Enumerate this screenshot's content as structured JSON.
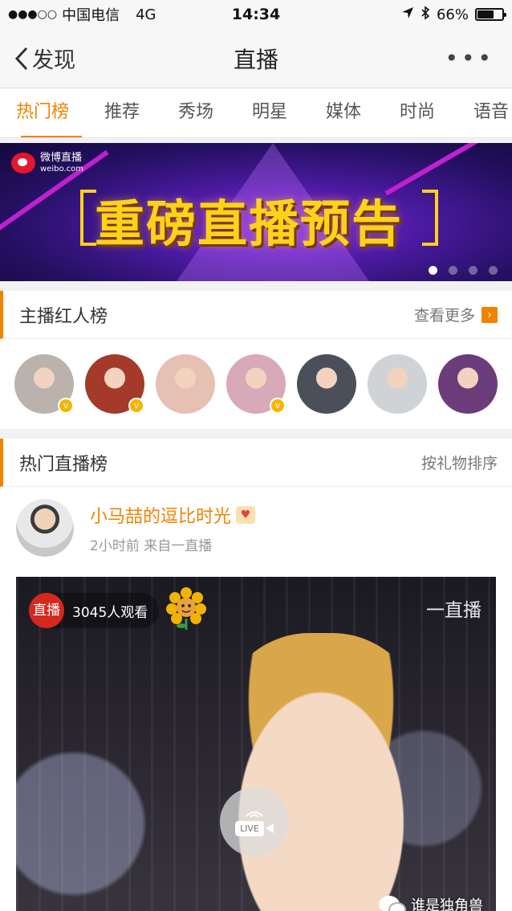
{
  "status_bar": {
    "carrier": "中国电信",
    "network": "4G",
    "time": "14:34",
    "battery": "66%",
    "battery_level": 0.66
  },
  "nav": {
    "back_label": "发现",
    "title": "直播",
    "more_label": "•••"
  },
  "tabs": [
    {
      "label": "热门榜",
      "active": true
    },
    {
      "label": "推荐"
    },
    {
      "label": "秀场"
    },
    {
      "label": "明星"
    },
    {
      "label": "媒体"
    },
    {
      "label": "时尚"
    },
    {
      "label": "语音"
    }
  ],
  "banner": {
    "logo_text": "微博直播",
    "logo_sub": "weibo.com",
    "headline": "重磅直播预告",
    "pages": 4,
    "active_page": 1
  },
  "anchors": {
    "title": "主播红人榜",
    "more_label": "查看更多",
    "avatars": [
      {
        "verified": true,
        "color": "#b9b2ad"
      },
      {
        "verified": true,
        "color": "#a33a2a"
      },
      {
        "verified": false,
        "color": "#e6c0b2"
      },
      {
        "verified": true,
        "color": "#d7a9b9"
      },
      {
        "verified": false,
        "color": "#4a4f5a"
      },
      {
        "verified": false,
        "color": "#cfd3d6"
      },
      {
        "verified": false,
        "color": "#6b3b7a"
      }
    ]
  },
  "hot_live": {
    "title": "热门直播榜",
    "sort_label": "按礼物排序",
    "post": {
      "user_name": "小马喆的逗比时光",
      "meta": "2小时前  来自一直播",
      "live_tag": "直播",
      "viewers": "3045人观看",
      "brand": "一直播",
      "camera_label": "LIVE"
    }
  },
  "watermark": "谁是独角兽",
  "colors": {
    "accent": "#f08300",
    "live_red": "#d5281e"
  }
}
